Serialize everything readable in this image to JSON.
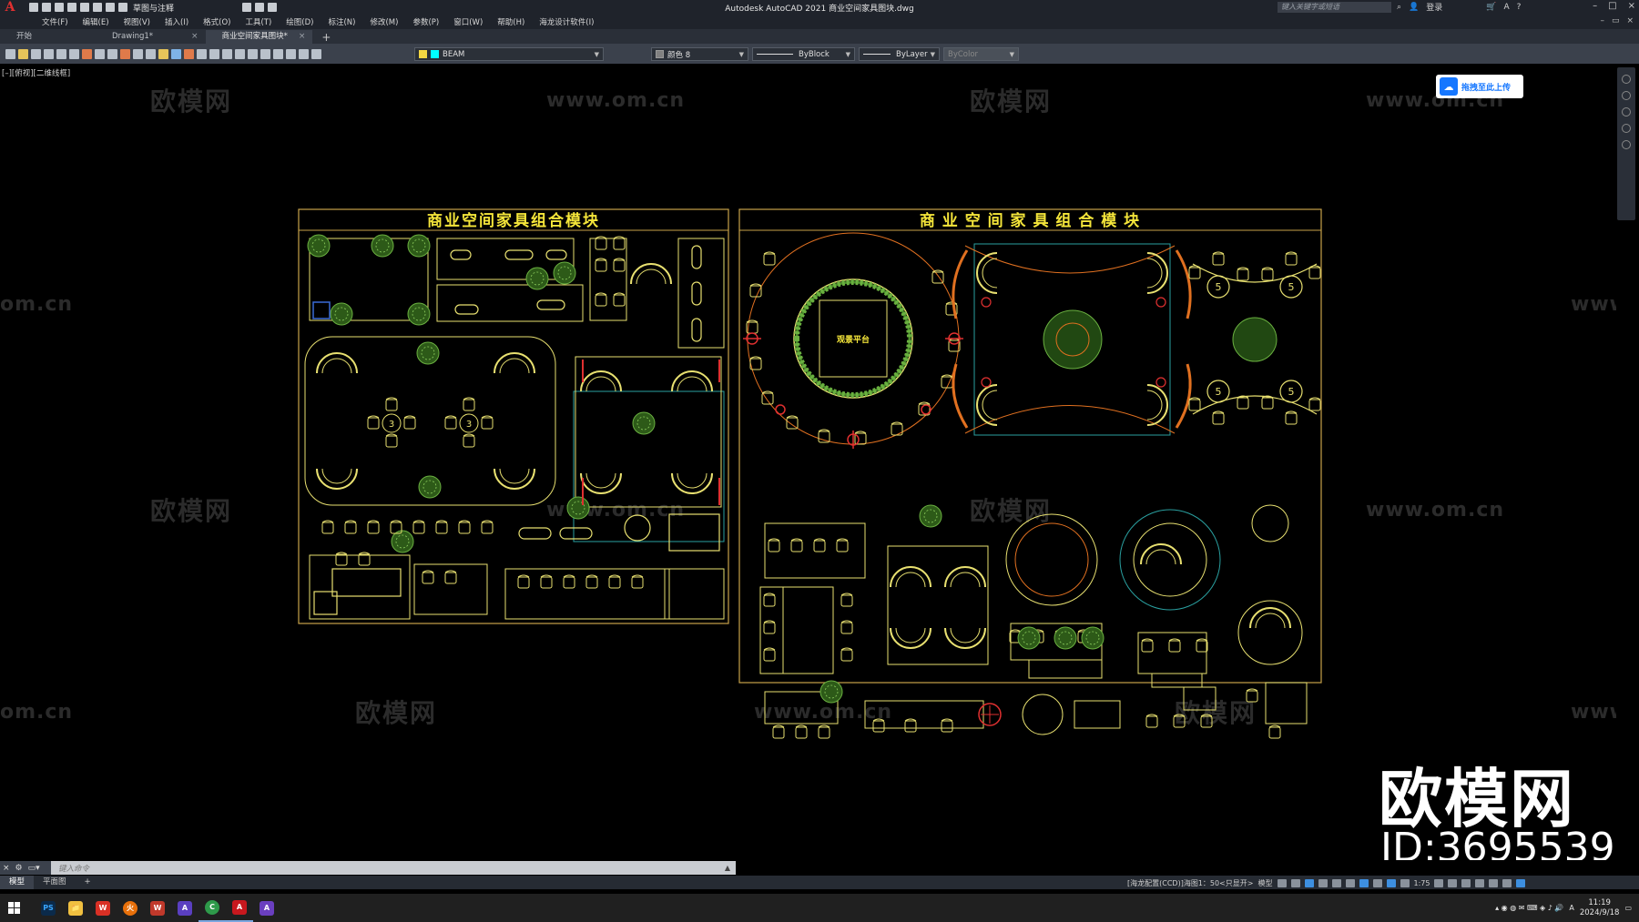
{
  "titlebar": {
    "workspace": "草图与注释",
    "title": "Autodesk AutoCAD 2021    商业空间家具图块.dwg",
    "search_placeholder": "键入关键字或短语",
    "login": "登录",
    "window_controls": [
      "–",
      "□",
      "×"
    ]
  },
  "menu": [
    "文件(F)",
    "编辑(E)",
    "视图(V)",
    "插入(I)",
    "格式(O)",
    "工具(T)",
    "绘图(D)",
    "标注(N)",
    "修改(M)",
    "参数(P)",
    "窗口(W)",
    "帮助(H)",
    "海龙设计软件(I)"
  ],
  "tabs": [
    {
      "label": "开始",
      "closable": false
    },
    {
      "label": "Drawing1*",
      "closable": true
    },
    {
      "label": "商业空间家具图块*",
      "closable": true
    }
  ],
  "toolbar": {
    "layer": "BEAM",
    "color": "颜色 8",
    "linetype": "ByBlock",
    "lineweight": "ByLayer",
    "plotstyle": "ByColor",
    "layer_color": "#00ffff"
  },
  "canvas": {
    "viewport_label": "[–][俯视][二维线框]",
    "upload_button": "拖拽至此上传",
    "drawing_left_title": "商业空间家具组合模块",
    "drawing_right_title": "商 业 空 间 家 具 组 合 模 块",
    "stage_label": "观景平台",
    "table_numbers": [
      "3",
      "3",
      "5",
      "5",
      "5",
      "5"
    ],
    "watermark_cn": "欧模网",
    "watermark_url": "www.om.cn",
    "watermark_url_partial": "om.cn",
    "brand_name": "欧模网",
    "brand_id": "ID:3695539"
  },
  "colors": {
    "frame": "#c8a24a",
    "title_yellow": "#f5e63a",
    "furniture_yellow": "#e8e070",
    "plant_green": "#4a8c2a",
    "accent_orange": "#e07020",
    "accent_red": "#e03030",
    "cyan": "#2aa0a0"
  },
  "command": {
    "placeholder": "键入命令"
  },
  "layout_tabs": [
    "模型",
    "平面图"
  ],
  "status": {
    "scale_info": "[海龙配置(CCD)]海图1：50<只显开>",
    "model": "模型",
    "anno_scale": "1:75"
  },
  "taskbar": {
    "apps": [
      "PS",
      "📁",
      "W",
      "火",
      "W",
      "A",
      "C",
      "A",
      "A"
    ],
    "time": "11:19",
    "date": "2024/9/18"
  }
}
